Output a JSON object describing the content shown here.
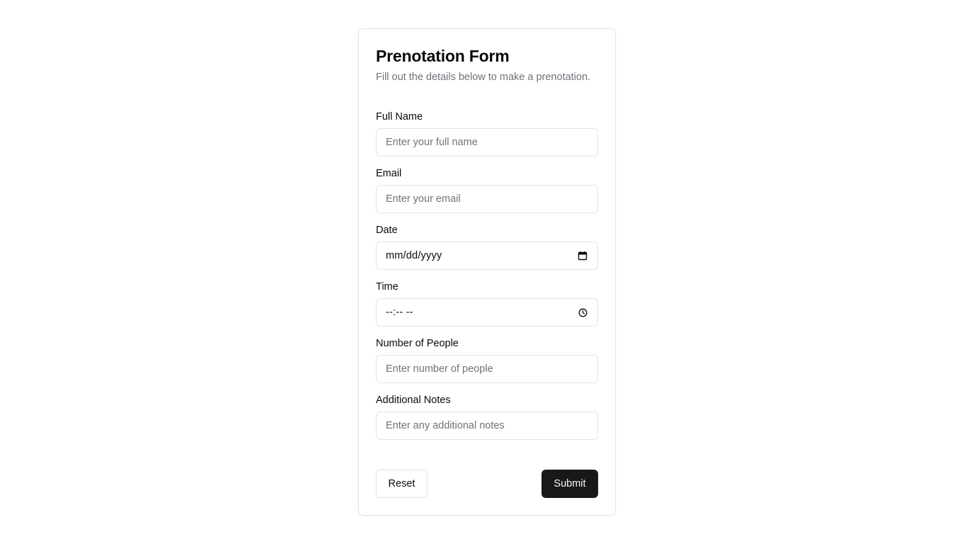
{
  "form": {
    "title": "Prenotation Form",
    "subtitle": "Fill out the details below to make a prenotation.",
    "fields": {
      "full_name": {
        "label": "Full Name",
        "placeholder": "Enter your full name"
      },
      "email": {
        "label": "Email",
        "placeholder": "Enter your email"
      },
      "date": {
        "label": "Date",
        "value": "mm/dd/yyyy",
        "icon": "calendar-icon"
      },
      "time": {
        "label": "Time",
        "value": "--:-- --",
        "icon": "clock-icon"
      },
      "people": {
        "label": "Number of People",
        "placeholder": "Enter number of people"
      },
      "notes": {
        "label": "Additional Notes",
        "placeholder": "Enter any additional notes"
      }
    },
    "actions": {
      "reset_label": "Reset",
      "submit_label": "Submit"
    }
  },
  "colors": {
    "primary": "#18181b",
    "border": "#e4e4e7",
    "muted_text": "#71717a",
    "text": "#0a0a0a"
  }
}
